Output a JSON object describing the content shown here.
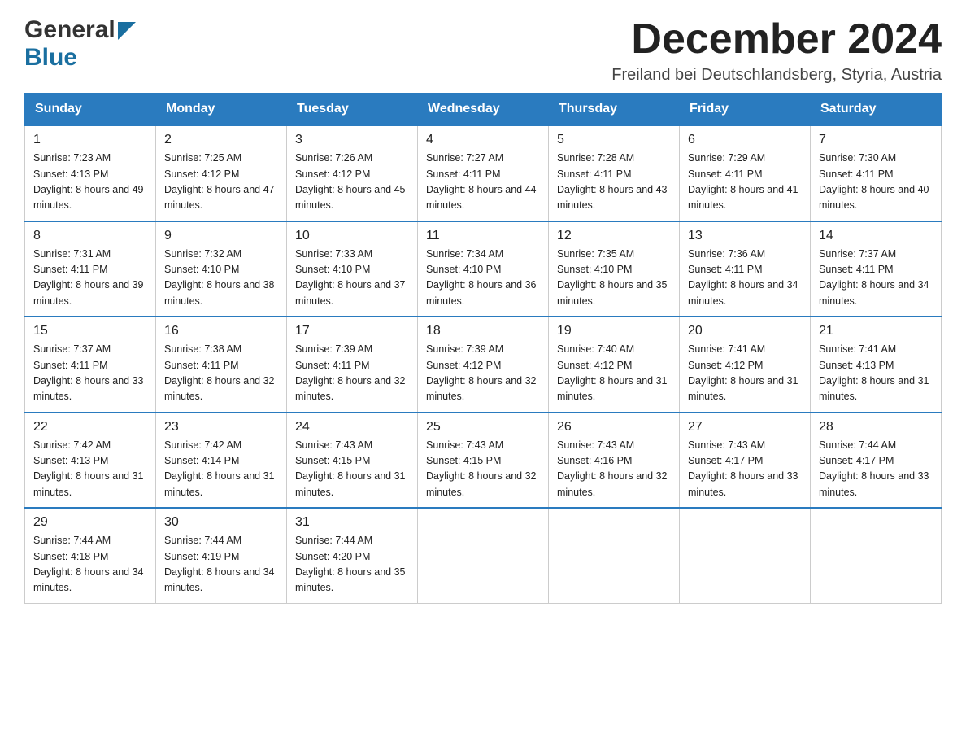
{
  "header": {
    "logo_general": "General",
    "logo_blue": "Blue",
    "month_title": "December 2024",
    "location": "Freiland bei Deutschlandsberg, Styria, Austria"
  },
  "days_of_week": [
    "Sunday",
    "Monday",
    "Tuesday",
    "Wednesday",
    "Thursday",
    "Friday",
    "Saturday"
  ],
  "weeks": [
    [
      {
        "day": "1",
        "sunrise": "7:23 AM",
        "sunset": "4:13 PM",
        "daylight": "8 hours and 49 minutes."
      },
      {
        "day": "2",
        "sunrise": "7:25 AM",
        "sunset": "4:12 PM",
        "daylight": "8 hours and 47 minutes."
      },
      {
        "day": "3",
        "sunrise": "7:26 AM",
        "sunset": "4:12 PM",
        "daylight": "8 hours and 45 minutes."
      },
      {
        "day": "4",
        "sunrise": "7:27 AM",
        "sunset": "4:11 PM",
        "daylight": "8 hours and 44 minutes."
      },
      {
        "day": "5",
        "sunrise": "7:28 AM",
        "sunset": "4:11 PM",
        "daylight": "8 hours and 43 minutes."
      },
      {
        "day": "6",
        "sunrise": "7:29 AM",
        "sunset": "4:11 PM",
        "daylight": "8 hours and 41 minutes."
      },
      {
        "day": "7",
        "sunrise": "7:30 AM",
        "sunset": "4:11 PM",
        "daylight": "8 hours and 40 minutes."
      }
    ],
    [
      {
        "day": "8",
        "sunrise": "7:31 AM",
        "sunset": "4:11 PM",
        "daylight": "8 hours and 39 minutes."
      },
      {
        "day": "9",
        "sunrise": "7:32 AM",
        "sunset": "4:10 PM",
        "daylight": "8 hours and 38 minutes."
      },
      {
        "day": "10",
        "sunrise": "7:33 AM",
        "sunset": "4:10 PM",
        "daylight": "8 hours and 37 minutes."
      },
      {
        "day": "11",
        "sunrise": "7:34 AM",
        "sunset": "4:10 PM",
        "daylight": "8 hours and 36 minutes."
      },
      {
        "day": "12",
        "sunrise": "7:35 AM",
        "sunset": "4:10 PM",
        "daylight": "8 hours and 35 minutes."
      },
      {
        "day": "13",
        "sunrise": "7:36 AM",
        "sunset": "4:11 PM",
        "daylight": "8 hours and 34 minutes."
      },
      {
        "day": "14",
        "sunrise": "7:37 AM",
        "sunset": "4:11 PM",
        "daylight": "8 hours and 34 minutes."
      }
    ],
    [
      {
        "day": "15",
        "sunrise": "7:37 AM",
        "sunset": "4:11 PM",
        "daylight": "8 hours and 33 minutes."
      },
      {
        "day": "16",
        "sunrise": "7:38 AM",
        "sunset": "4:11 PM",
        "daylight": "8 hours and 32 minutes."
      },
      {
        "day": "17",
        "sunrise": "7:39 AM",
        "sunset": "4:11 PM",
        "daylight": "8 hours and 32 minutes."
      },
      {
        "day": "18",
        "sunrise": "7:39 AM",
        "sunset": "4:12 PM",
        "daylight": "8 hours and 32 minutes."
      },
      {
        "day": "19",
        "sunrise": "7:40 AM",
        "sunset": "4:12 PM",
        "daylight": "8 hours and 31 minutes."
      },
      {
        "day": "20",
        "sunrise": "7:41 AM",
        "sunset": "4:12 PM",
        "daylight": "8 hours and 31 minutes."
      },
      {
        "day": "21",
        "sunrise": "7:41 AM",
        "sunset": "4:13 PM",
        "daylight": "8 hours and 31 minutes."
      }
    ],
    [
      {
        "day": "22",
        "sunrise": "7:42 AM",
        "sunset": "4:13 PM",
        "daylight": "8 hours and 31 minutes."
      },
      {
        "day": "23",
        "sunrise": "7:42 AM",
        "sunset": "4:14 PM",
        "daylight": "8 hours and 31 minutes."
      },
      {
        "day": "24",
        "sunrise": "7:43 AM",
        "sunset": "4:15 PM",
        "daylight": "8 hours and 31 minutes."
      },
      {
        "day": "25",
        "sunrise": "7:43 AM",
        "sunset": "4:15 PM",
        "daylight": "8 hours and 32 minutes."
      },
      {
        "day": "26",
        "sunrise": "7:43 AM",
        "sunset": "4:16 PM",
        "daylight": "8 hours and 32 minutes."
      },
      {
        "day": "27",
        "sunrise": "7:43 AM",
        "sunset": "4:17 PM",
        "daylight": "8 hours and 33 minutes."
      },
      {
        "day": "28",
        "sunrise": "7:44 AM",
        "sunset": "4:17 PM",
        "daylight": "8 hours and 33 minutes."
      }
    ],
    [
      {
        "day": "29",
        "sunrise": "7:44 AM",
        "sunset": "4:18 PM",
        "daylight": "8 hours and 34 minutes."
      },
      {
        "day": "30",
        "sunrise": "7:44 AM",
        "sunset": "4:19 PM",
        "daylight": "8 hours and 34 minutes."
      },
      {
        "day": "31",
        "sunrise": "7:44 AM",
        "sunset": "4:20 PM",
        "daylight": "8 hours and 35 minutes."
      },
      null,
      null,
      null,
      null
    ]
  ],
  "labels": {
    "sunrise_prefix": "Sunrise: ",
    "sunset_prefix": "Sunset: ",
    "daylight_prefix": "Daylight: "
  }
}
